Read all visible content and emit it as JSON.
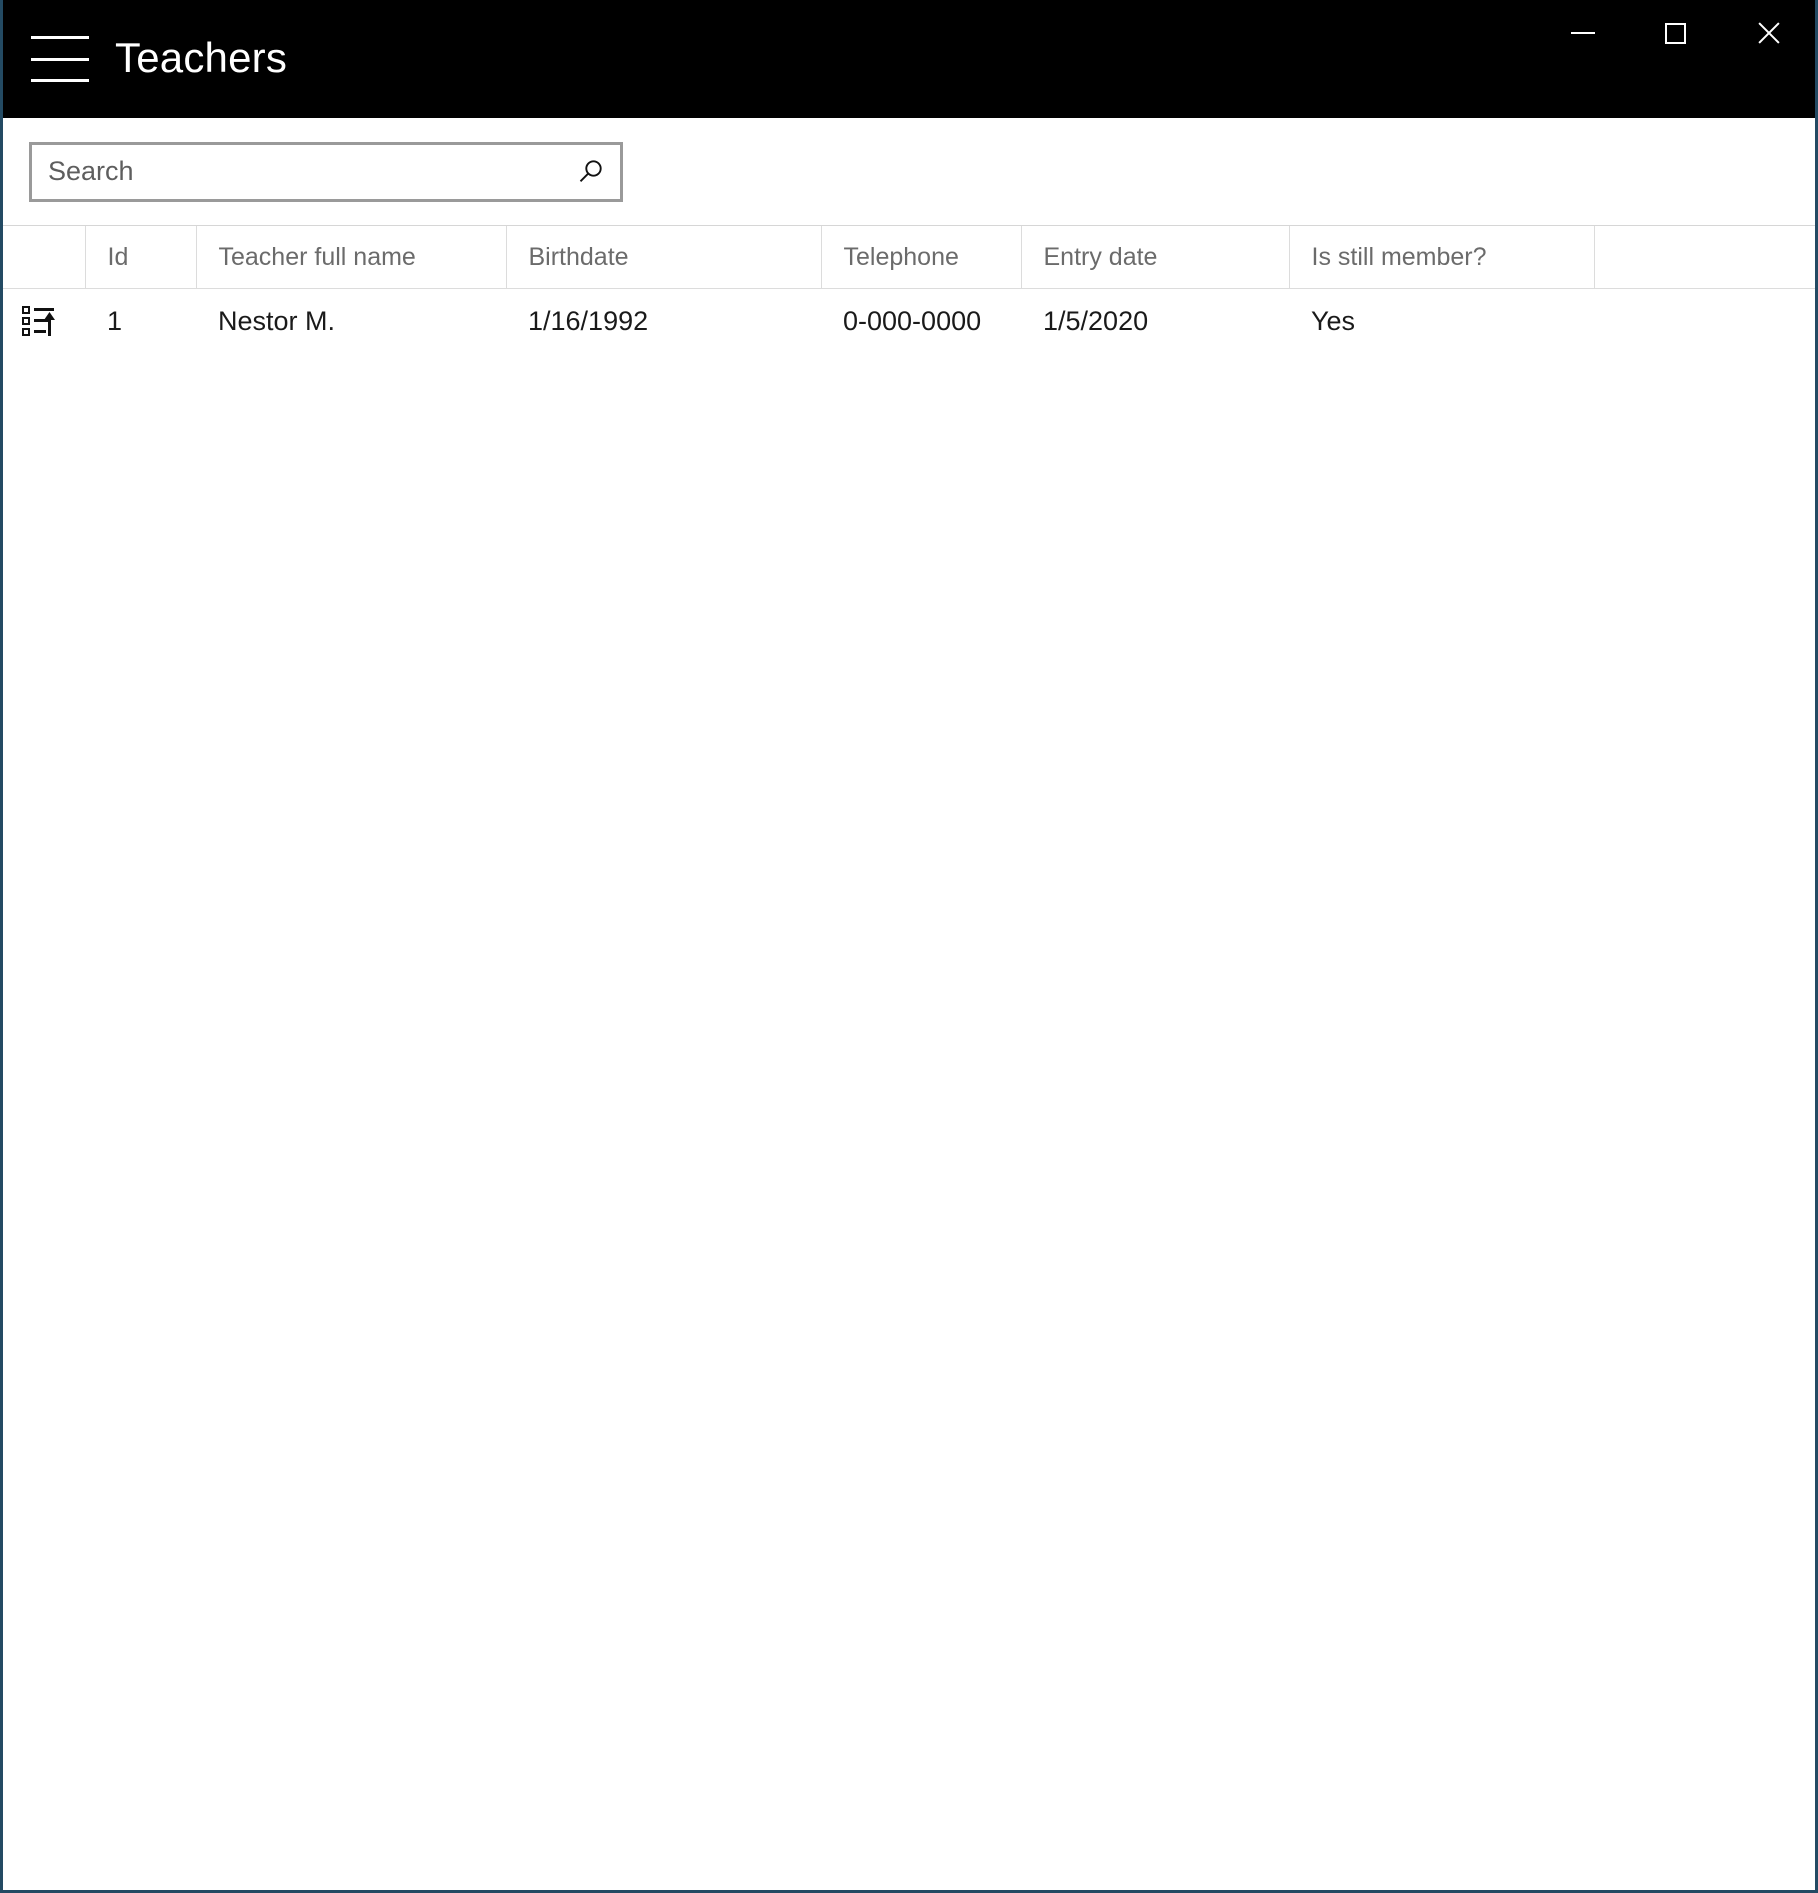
{
  "window": {
    "border_color": "#234a63",
    "titlebar_background": "#000000",
    "title": "Teachers",
    "menu_icon": "hamburger-menu-icon",
    "controls": [
      {
        "name": "minimize",
        "label": "–"
      },
      {
        "name": "maximize",
        "label": "□"
      },
      {
        "name": "close",
        "label": "✕"
      }
    ]
  },
  "search": {
    "value": "",
    "placeholder": "Search",
    "icon": "search-magnifier-icon",
    "border_color": "#9a9a9a"
  },
  "table": {
    "columns": [
      {
        "key": "handle",
        "label": ""
      },
      {
        "key": "id",
        "label": "Id"
      },
      {
        "key": "name",
        "label": "Teacher full name"
      },
      {
        "key": "birthdate",
        "label": "Birthdate"
      },
      {
        "key": "telephone",
        "label": "Telephone"
      },
      {
        "key": "entry_date",
        "label": "Entry date"
      },
      {
        "key": "member",
        "label": "Is still member?"
      },
      {
        "key": "spacer",
        "label": ""
      }
    ],
    "rows": [
      {
        "handle_icon": "list-sort-ascending-icon",
        "id": "1",
        "name": "Nestor M.",
        "birthdate": "1/16/1992",
        "telephone": "0-000-0000",
        "entry_date": "1/5/2020",
        "member": "Yes"
      }
    ],
    "header_text_color": "#6b6b6b",
    "grid_line_color": "#dcdcdc"
  }
}
